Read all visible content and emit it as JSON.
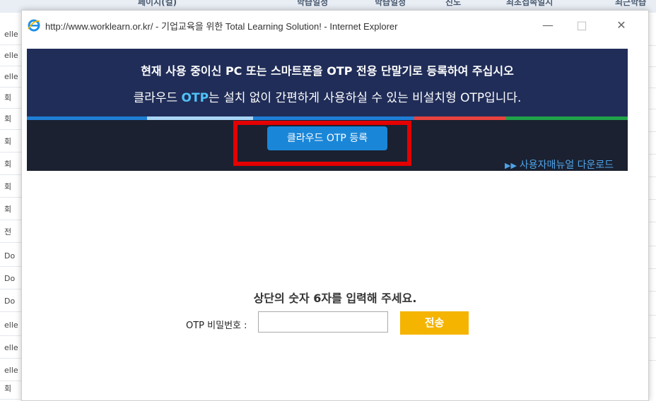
{
  "background": {
    "header_columns": [
      "페이지(컬)",
      "학습일정",
      "학습일정",
      "진도",
      "최초접속일시",
      "최근학습"
    ],
    "left_rows": [
      "elle",
      "elle",
      "elle",
      "회",
      "회",
      "회",
      "회",
      "회",
      "회",
      "전",
      "Do",
      "Do",
      "Do",
      "elle",
      "elle",
      "elle",
      "회"
    ]
  },
  "window": {
    "title": "http://www.worklearn.or.kr/ - 기업교육을 위한 Total Learning Solution! - Internet Explorer",
    "minimize": "—",
    "maximize": "□",
    "close": "✕"
  },
  "banner": {
    "line1_a": "현재 사용 중이신 ",
    "line1_b": "PC",
    "line1_c": " 또는 스마트폰을 ",
    "line1_d": "OTP",
    "line1_e": " 전용 단말기로 등록하여 주십시오",
    "line2_a": "클라우드 ",
    "line2_b": "OTP",
    "line2_c": "는 설치 없이 간편하게 사용하실 수 있는 비설치형 OTP입니다.",
    "register_button": "클라우드 OTP 등록",
    "manual_arrow": "▶▶",
    "manual_link": "사용자매뉴얼 다운로드",
    "colors": {
      "banner_bg": "#202d58",
      "stripe_blue": "#1f7fd6",
      "stripe_light": "#a9d4f5",
      "stripe_red": "#e8423f",
      "stripe_green": "#1fa34a",
      "highlight": "#e40000"
    }
  },
  "form": {
    "prompt": "상단의 숫자 6자를 입력해 주세요.",
    "otp_label": "OTP 비밀번호 :",
    "otp_value": "",
    "submit": "전송"
  }
}
